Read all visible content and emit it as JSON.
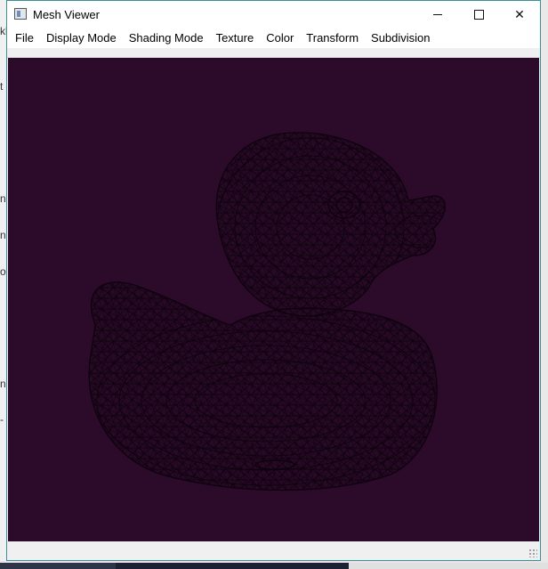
{
  "window": {
    "title": "Mesh Viewer"
  },
  "title_buttons": {
    "minimize": "",
    "maximize": "",
    "close": "✕"
  },
  "menu": {
    "items": [
      "File",
      "Display Mode",
      "Shading Mode",
      "Texture",
      "Color",
      "Transform",
      "Subdivision"
    ]
  },
  "background": {
    "fragments": [
      "kl",
      "t",
      "n",
      "ne",
      "oc",
      "na",
      "-"
    ]
  },
  "viewport": {
    "background_color": "#2c0a2a",
    "wire_color": "#0d020d",
    "model": "rubber duck wireframe mesh"
  }
}
